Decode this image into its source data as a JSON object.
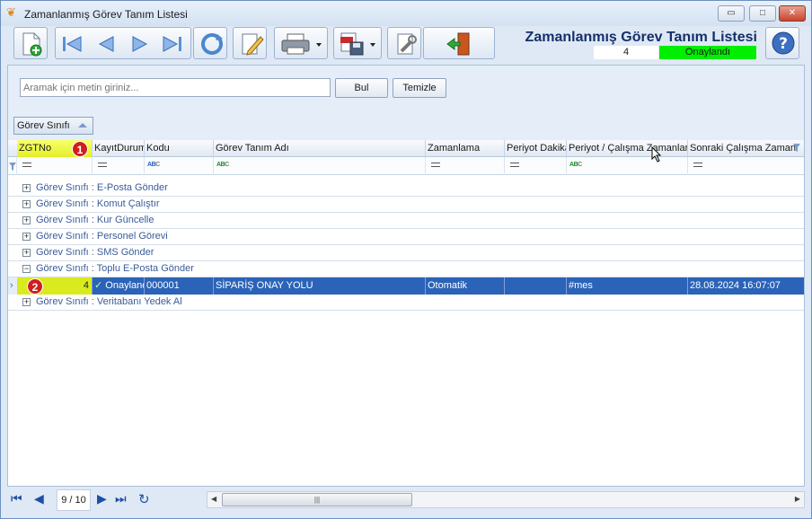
{
  "window": {
    "title": "Zamanlanmış Görev Tanım Listesi",
    "minimize": "▭",
    "maximize": "□",
    "close": "✕"
  },
  "header": {
    "title": "Zamanlanmış Görev Tanım Listesi",
    "record_number": "4",
    "status": "Onaylandı",
    "status_color": "#00ee00"
  },
  "search": {
    "placeholder": "Aramak için metin giriniz...",
    "find_label": "Bul",
    "clear_label": "Temizle"
  },
  "group_panel": {
    "chip_label": "Görev Sınıfı"
  },
  "grid": {
    "columns": [
      "ZGTNo",
      "KayıtDurum",
      "Kodu",
      "Görev Tanım Adı",
      "Zamanlama",
      "Periyot Dakika",
      "Periyot / Çalışma Zamanları",
      "Sonraki Çalışma Zamanı"
    ],
    "groups": [
      "Görev Sınıfı : E-Posta Gönder",
      "Görev Sınıfı : Komut Çalıştır",
      "Görev Sınıfı : Kur Güncelle",
      "Görev Sınıfı : Personel Görevi",
      "Görev Sınıfı : SMS Gönder",
      "Görev Sınıfı : Toplu E-Posta Gönder",
      "Görev Sınıfı : Veritabanı Yedek Al"
    ],
    "selected_row": {
      "zgtno": "4",
      "status": "Onaylandı",
      "code": "000001",
      "name": "SİPARİŞ ONAY YOLU",
      "schedule": "Otomatik",
      "period_minutes": "",
      "period_times": "#mes",
      "next_run": "28.08.2024 16:07:07"
    },
    "badges": [
      "1",
      "2"
    ]
  },
  "footer": {
    "page_indicator": "9 / 10",
    "scroll_thumb": "|||"
  }
}
